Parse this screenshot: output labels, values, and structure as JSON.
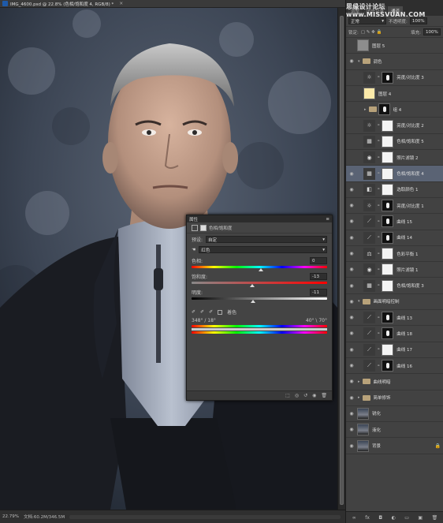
{
  "document": {
    "tab_title": "IMG_4600.psd @ 22.8% (色相/饱和度 4, RGB/8) *",
    "zoom": "22.79%",
    "doc_info": "文档:60.2M/346.5M"
  },
  "panel": {
    "tabs": [
      "调整",
      "历史记录",
      "通道"
    ],
    "watermark": "思缘设计论坛 www.MISSVUAN.COM",
    "blend_mode": "正常",
    "opacity_label": "不透明度:",
    "opacity_value": "100%",
    "lock_label": "锁定:",
    "fill_label": "填充:",
    "fill_value": "100%"
  },
  "layers": [
    {
      "name": "图层 5",
      "thumb": "gray",
      "eye": false,
      "type": "layer"
    },
    {
      "name": "调色",
      "thumb": "folder",
      "eye": true,
      "type": "group",
      "open": true
    },
    {
      "name": "亮度/对比度 3",
      "thumb": "adj",
      "icon": "☼",
      "mask": "dark",
      "eye": false,
      "type": "adj",
      "indent": true
    },
    {
      "name": "图层 4",
      "thumb": "paper",
      "eye": false,
      "type": "layer",
      "indent": true
    },
    {
      "name": "组 4",
      "thumb": "folder",
      "eye": false,
      "type": "group",
      "indent": true,
      "mask": "dark"
    },
    {
      "name": "亮度/对比度 2",
      "thumb": "adj",
      "icon": "☼",
      "mask": "white",
      "eye": false,
      "type": "adj",
      "indent": true
    },
    {
      "name": "色相/饱和度 5",
      "thumb": "adj",
      "icon": "▦",
      "mask": "white",
      "eye": false,
      "type": "adj",
      "indent": true
    },
    {
      "name": "照片滤镜 2",
      "thumb": "adj",
      "icon": "◉",
      "mask": "white",
      "eye": false,
      "type": "adj",
      "indent": true
    },
    {
      "name": "色相/饱和度 4",
      "thumb": "adj",
      "icon": "▦",
      "mask": "white",
      "eye": true,
      "type": "adj",
      "indent": true,
      "selected": true
    },
    {
      "name": "选取颜色 1",
      "thumb": "adj",
      "icon": "◧",
      "mask": "white",
      "eye": true,
      "type": "adj",
      "indent": true
    },
    {
      "name": "亮度/对比度 1",
      "thumb": "adj",
      "icon": "☼",
      "mask": "dark",
      "eye": true,
      "type": "adj",
      "indent": true
    },
    {
      "name": "曲线 15",
      "thumb": "adj",
      "icon": "⟋",
      "mask": "dark",
      "eye": true,
      "type": "adj",
      "indent": true
    },
    {
      "name": "曲线 14",
      "thumb": "adj",
      "icon": "⟋",
      "mask": "dark",
      "eye": true,
      "type": "adj",
      "indent": true
    },
    {
      "name": "色彩平衡 1",
      "thumb": "adj",
      "icon": "⚖",
      "mask": "white",
      "eye": true,
      "type": "adj",
      "indent": true
    },
    {
      "name": "照片滤镜 1",
      "thumb": "adj",
      "icon": "◉",
      "mask": "white",
      "eye": true,
      "type": "adj",
      "indent": true
    },
    {
      "name": "色相/饱和度 3",
      "thumb": "adj",
      "icon": "▦",
      "mask": "white",
      "eye": true,
      "type": "adj",
      "indent": true
    },
    {
      "name": "画面明暗控制",
      "thumb": "folder",
      "eye": true,
      "type": "group",
      "open": true
    },
    {
      "name": "曲线 13",
      "thumb": "adj",
      "icon": "⟋",
      "mask": "dark",
      "eye": true,
      "type": "adj",
      "indent": true
    },
    {
      "name": "曲线 18",
      "thumb": "adj",
      "icon": "⟋",
      "mask": "dark",
      "eye": true,
      "type": "adj",
      "indent": true
    },
    {
      "name": "曲线 17",
      "thumb": "adj",
      "icon": "⟋",
      "mask": "white",
      "eye": true,
      "type": "adj",
      "indent": true
    },
    {
      "name": "曲线 16",
      "thumb": "adj",
      "icon": "⟋",
      "mask": "dark",
      "eye": true,
      "type": "adj",
      "indent": true
    },
    {
      "name": "曲线明暗",
      "thumb": "folder",
      "eye": true,
      "type": "group",
      "open": false
    },
    {
      "name": "简单修饰",
      "thumb": "folder",
      "eye": true,
      "type": "group",
      "open": false
    },
    {
      "name": "锐化",
      "thumb": "img",
      "eye": true,
      "type": "layer"
    },
    {
      "name": "液化",
      "thumb": "img",
      "eye": true,
      "type": "layer"
    },
    {
      "name": "背景",
      "thumb": "img",
      "eye": true,
      "type": "layer",
      "locked": true
    }
  ],
  "properties": {
    "panel_title": "属性",
    "adjust_name": "色相/饱和度",
    "preset_label": "预设:",
    "preset_value": "自定",
    "channel_value": "红色",
    "hue_label": "色相:",
    "hue_value": "0",
    "sat_label": "饱和度:",
    "sat_value": "-13",
    "light_label": "明度:",
    "light_value": "-11",
    "colorize_label": "着色",
    "range_left": "348° / 18°",
    "range_right": "40° \\ 70°"
  }
}
